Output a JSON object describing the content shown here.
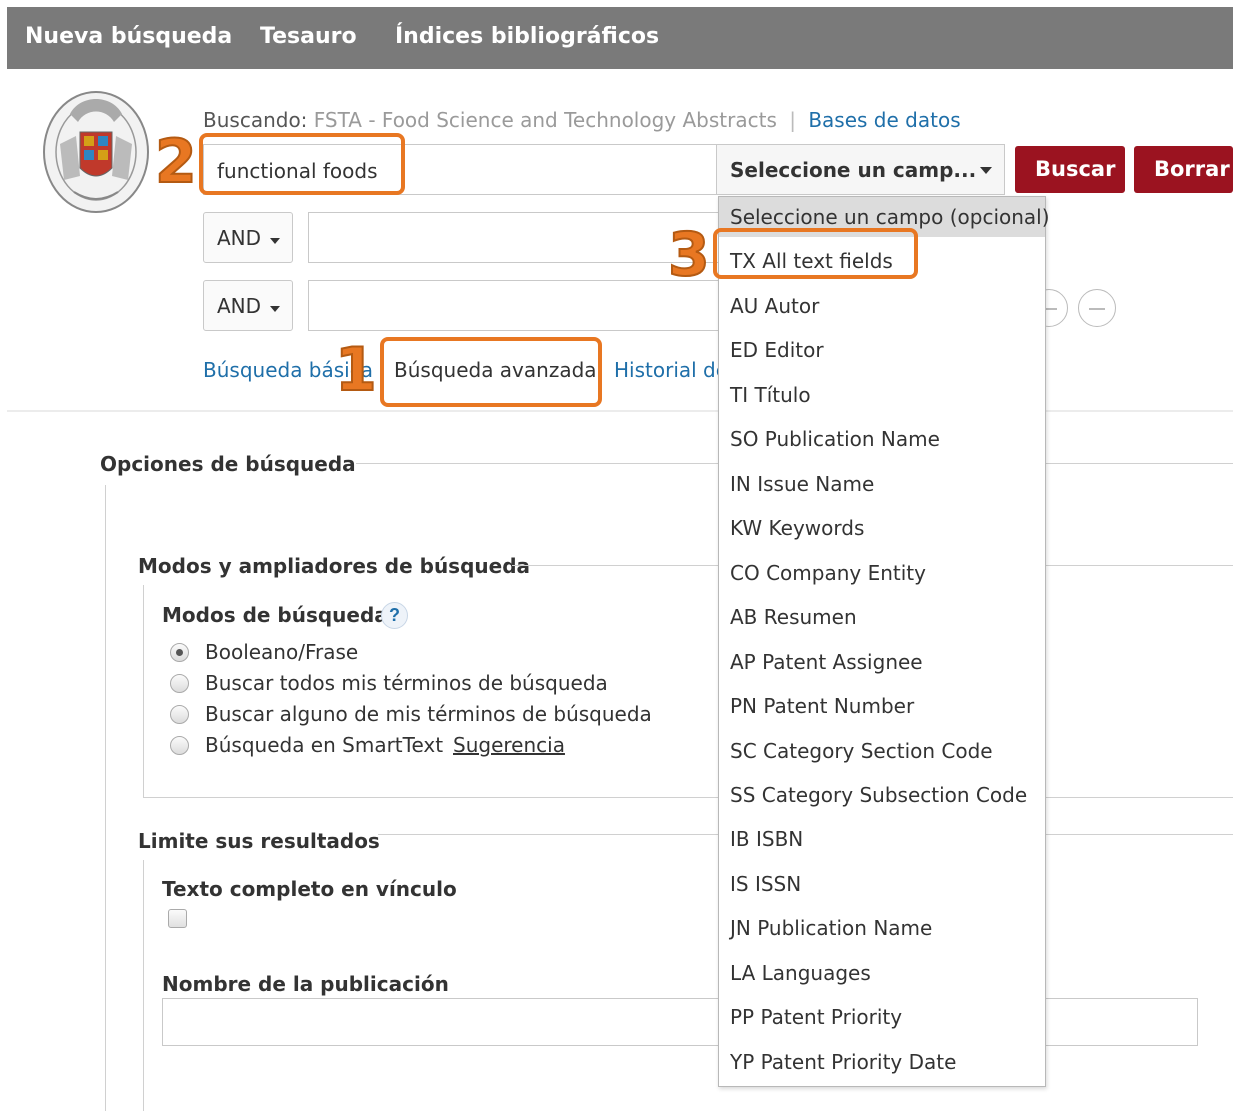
{
  "topnav": {
    "items": [
      "Nueva búsqueda",
      "Tesauro",
      "Índices bibliográficos"
    ]
  },
  "search": {
    "searching_label": "Buscando:",
    "database_name": "FSTA - Food Science and Technology Abstracts",
    "databases_link": "Bases de datos",
    "query_value": "functional foods",
    "field_select_value": "Seleccione un camp...",
    "search_button": "Buscar",
    "clear_button": "Borrar",
    "rows": [
      {
        "operator": "AND",
        "value": ""
      },
      {
        "operator": "AND",
        "value": ""
      }
    ]
  },
  "links": {
    "basic": "Búsqueda básica",
    "advanced": "Búsqueda avanzada",
    "history": "Historial de búsqueda"
  },
  "options": {
    "title": "Opciones de búsqueda",
    "modes_section": "Modos y ampliadores de búsqueda",
    "modes_label": "Modos de búsqueda",
    "help_icon": "?",
    "modes": [
      {
        "label": "Booleano/Frase",
        "checked": true
      },
      {
        "label": "Buscar todos mis términos de búsqueda",
        "checked": false
      },
      {
        "label": "Buscar alguno de mis términos de búsqueda",
        "checked": false
      },
      {
        "label": "Búsqueda en SmartText",
        "checked": false
      }
    ],
    "suggestion_link": "Sugerencia",
    "limit_section": "Limite sus resultados",
    "fulltext_label": "Texto completo en vínculo",
    "pubname_label": "Nombre de la publicación"
  },
  "dropdown": {
    "items": [
      "Seleccione un campo (opcional)",
      "TX All text fields",
      "AU Autor",
      "ED Editor",
      "TI Título",
      "SO Publication Name",
      "IN Issue Name",
      "KW Keywords",
      "CO Company Entity",
      "AB Resumen",
      "AP Patent Assignee",
      "PN Patent Number",
      "SC Category Section Code",
      "SS Category Subsection Code",
      "IB ISBN",
      "IS ISSN",
      "JN Publication Name",
      "LA Languages",
      "PP Patent Priority",
      "YP Patent Priority Date"
    ]
  },
  "annotations": {
    "one": "1",
    "two": "2",
    "three": "3",
    "color": "#e87722"
  },
  "colors": {
    "nav_bg": "#7a7a7a",
    "button_red": "#9b1320",
    "link_blue": "#1f6fa9"
  }
}
